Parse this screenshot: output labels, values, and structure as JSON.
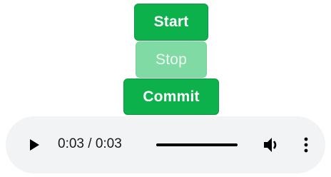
{
  "buttons": {
    "start_label": "Start",
    "stop_label": "Stop",
    "commit_label": "Commit"
  },
  "player": {
    "current_time": "0:03",
    "separator": "/",
    "duration": "0:03",
    "progress_fraction": 1.0,
    "icons": [
      "play-icon",
      "volume-icon",
      "more-options-icon"
    ]
  },
  "colors": {
    "primary_green": "#0db14b",
    "disabled_green": "#7fdba3",
    "player_background": "#f1f3f4"
  }
}
